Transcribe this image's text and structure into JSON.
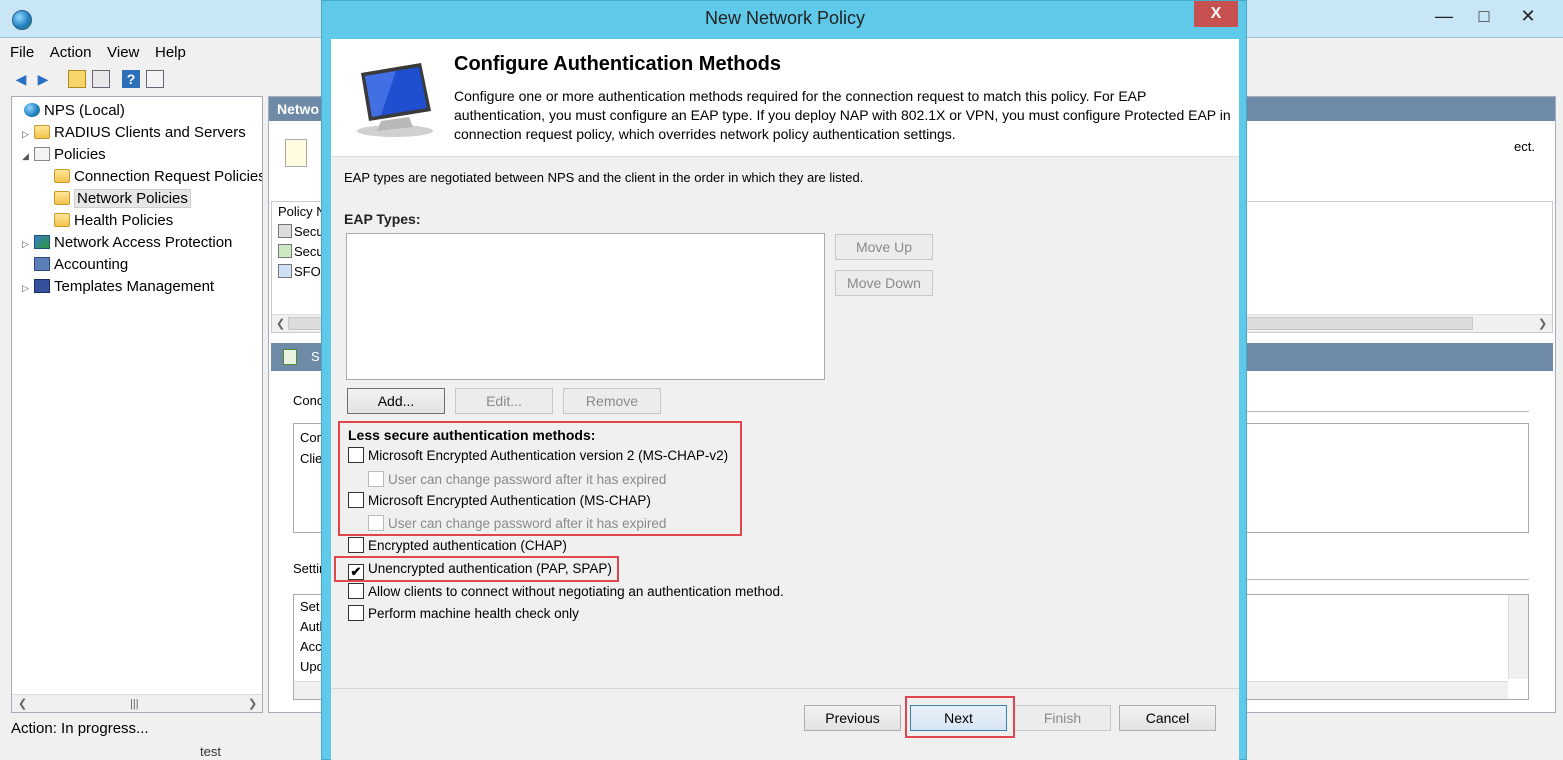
{
  "mmc": {
    "menu": [
      "File",
      "Action",
      "View",
      "Help"
    ],
    "window_controls": {
      "minimize": "—",
      "maximize": "□",
      "close": "✕"
    },
    "tree": [
      {
        "label": "NPS (Local)",
        "icon": "globe-icon"
      },
      {
        "label": "RADIUS Clients and Servers",
        "icon": "folder-icon"
      },
      {
        "label": "Policies",
        "icon": "policy-icon"
      },
      {
        "label": "Connection Request Policies",
        "icon": "folder-icon"
      },
      {
        "label": "Network Policies",
        "icon": "folder-icon"
      },
      {
        "label": "Health Policies",
        "icon": "folder-icon"
      },
      {
        "label": "Network Access Protection",
        "icon": "nap-icon"
      },
      {
        "label": "Accounting",
        "icon": "accounting-icon"
      },
      {
        "label": "Templates Management",
        "icon": "templates-icon"
      }
    ],
    "right_header": "Netwo",
    "right_desc_tail": "ect.",
    "policy_list": {
      "column": "Policy N",
      "rows": [
        "Secu",
        "Secu",
        "SFO"
      ]
    },
    "selected_bar": "S",
    "conditions_label": "Conc",
    "conditions_rows": [
      "Con",
      "Clie"
    ],
    "settings_label": "Settir",
    "settings_rows": [
      "Set",
      "Auth",
      "Acc",
      "Upd"
    ],
    "status": "Action:  In progress...",
    "bottom_fragment": "test"
  },
  "dialog": {
    "title": "New Network Policy",
    "close_label": "X",
    "header_title": "Configure Authentication Methods",
    "header_desc": "Configure one or more authentication methods required for the connection request to match this policy. For EAP authentication, you must configure an EAP type. If you deploy NAP with 802.1X or VPN, you must configure Protected EAP in connection request policy, which overrides network policy authentication settings.",
    "eap_note": "EAP types are negotiated between NPS and the client in the order in which they are listed.",
    "eap_label": "EAP Types:",
    "buttons": {
      "move_up": "Move Up",
      "move_down": "Move Down",
      "add": "Add...",
      "edit": "Edit...",
      "remove": "Remove",
      "previous": "Previous",
      "next": "Next",
      "finish": "Finish",
      "cancel": "Cancel"
    },
    "less_secure_label": "Less secure authentication methods:",
    "options": [
      {
        "label": "Microsoft Encrypted Authentication version 2 (MS-CHAP-v2)",
        "checked": false,
        "enabled": true
      },
      {
        "label": "User can change password after it has expired",
        "checked": false,
        "enabled": false
      },
      {
        "label": "Microsoft Encrypted Authentication (MS-CHAP)",
        "checked": false,
        "enabled": true
      },
      {
        "label": "User can change password after it has expired",
        "checked": false,
        "enabled": false
      },
      {
        "label": "Encrypted authentication (CHAP)",
        "checked": false,
        "enabled": true
      },
      {
        "label": "Unencrypted authentication (PAP, SPAP)",
        "checked": true,
        "enabled": true
      },
      {
        "label": "Allow clients to connect without negotiating an authentication method.",
        "checked": false,
        "enabled": true
      },
      {
        "label": "Perform machine health check only",
        "checked": false,
        "enabled": true
      }
    ],
    "check_mark": "✔"
  },
  "colors": {
    "dialog_frame": "#5fc9ea",
    "highlight": "#e0474c",
    "mmc_header": "#6e8aa6"
  }
}
